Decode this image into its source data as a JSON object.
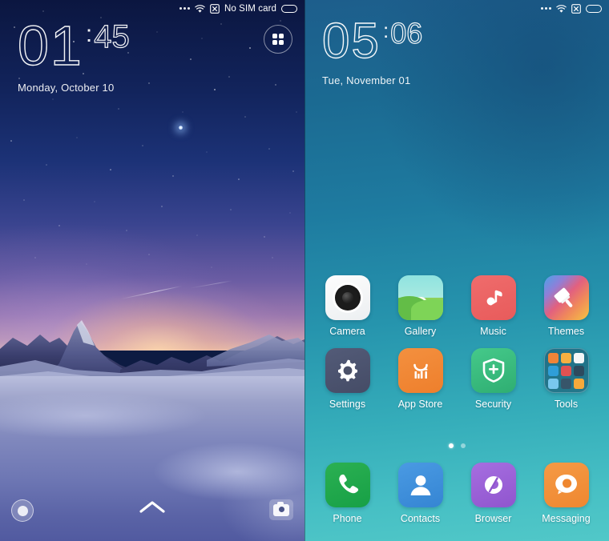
{
  "lock_screen": {
    "status_bar": {
      "more_icon": "three-dots-icon",
      "wifi_icon": "wifi-icon",
      "signal_icon": "no-signal-icon",
      "carrier_text": "No SIM card",
      "battery_icon": "battery-icon"
    },
    "clock": {
      "hours": "01",
      "separator": ":",
      "minutes": "45"
    },
    "date": "Monday, October 10",
    "shortcut_button": {
      "name": "app-shortcuts-button",
      "icon": "four-dots-grid-icon"
    },
    "bottom_bar": {
      "left_shortcut": "circle-shortcut-icon",
      "unlock_hint": "chevron-up-icon",
      "right_shortcut": "camera-shortcut-icon"
    }
  },
  "home_screen": {
    "status_bar": {
      "more_icon": "three-dots-icon",
      "wifi_icon": "wifi-icon",
      "signal_icon": "no-signal-icon",
      "battery_icon": "battery-icon"
    },
    "clock": {
      "hours": "05",
      "separator": ":",
      "minutes": "06"
    },
    "date": "Tue, November 01",
    "apps": [
      {
        "label": "Camera",
        "icon": "camera-icon",
        "color": "#F2F4F5"
      },
      {
        "label": "Gallery",
        "icon": "gallery-icon",
        "color": "#8FE3E0"
      },
      {
        "label": "Music",
        "icon": "music-note-icon",
        "color": "#EE6767"
      },
      {
        "label": "Themes",
        "icon": "paintbrush-icon",
        "color": "#E2607F"
      },
      {
        "label": "Settings",
        "icon": "gear-icon",
        "color": "#4A5068"
      },
      {
        "label": "App Store",
        "icon": "mi-bag-icon",
        "color": "#F08437"
      },
      {
        "label": "Security",
        "icon": "shield-plus-icon",
        "color": "#3FBE7D"
      },
      {
        "label": "Tools",
        "icon": "folder-grid-icon",
        "color": "#123A54"
      }
    ],
    "page_indicator": {
      "total": 2,
      "active": 1
    },
    "dock": [
      {
        "label": "Phone",
        "icon": "phone-handset-icon",
        "color": "#22A64A"
      },
      {
        "label": "Contacts",
        "icon": "person-icon",
        "color": "#3D8FDB"
      },
      {
        "label": "Browser",
        "icon": "browser-swirl-icon",
        "color": "#9B5FD6"
      },
      {
        "label": "Messaging",
        "icon": "speech-bubble-icon",
        "color": "#F0913C"
      }
    ]
  },
  "theme": {
    "lock_wallpaper": "starry-night-snow-mountain",
    "home_wallpaper_top": "#1D5E8C",
    "home_wallpaper_bottom": "#51C8C8"
  }
}
